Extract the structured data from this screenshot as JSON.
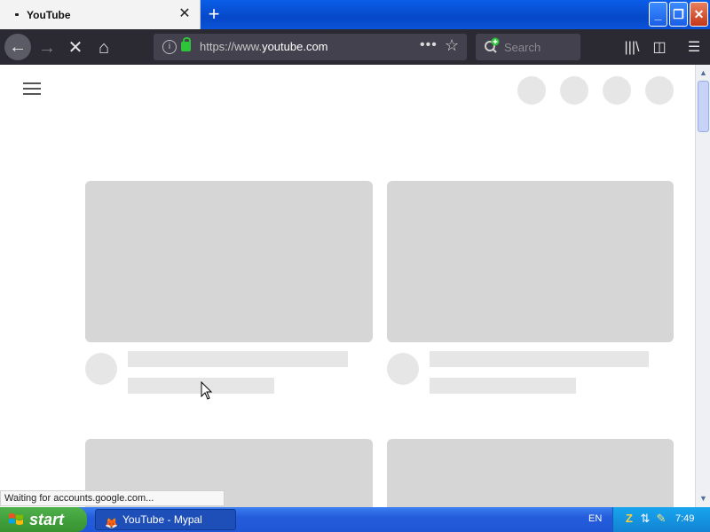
{
  "browser": {
    "tab": {
      "title": "YouTube",
      "close_glyph": "✕"
    },
    "new_tab_glyph": "+",
    "window_buttons": {
      "minimize": "_",
      "restore": "❐",
      "close": "✕"
    },
    "nav": {
      "back": "←",
      "forward": "→",
      "stop": "✕",
      "home": "⌂"
    },
    "url": {
      "prefix": "https://www.",
      "domain": "youtube.com"
    },
    "page_actions": "•••",
    "bookmark_star": "☆",
    "search_placeholder": "Search",
    "library": "|||\\",
    "sidebar": "◫",
    "menu": "☰"
  },
  "status_text": "Waiting for accounts.google.com...",
  "taskbar": {
    "start_label": "start",
    "task_label": "YouTube - Mypal",
    "language": "EN",
    "clock": "7:49"
  }
}
